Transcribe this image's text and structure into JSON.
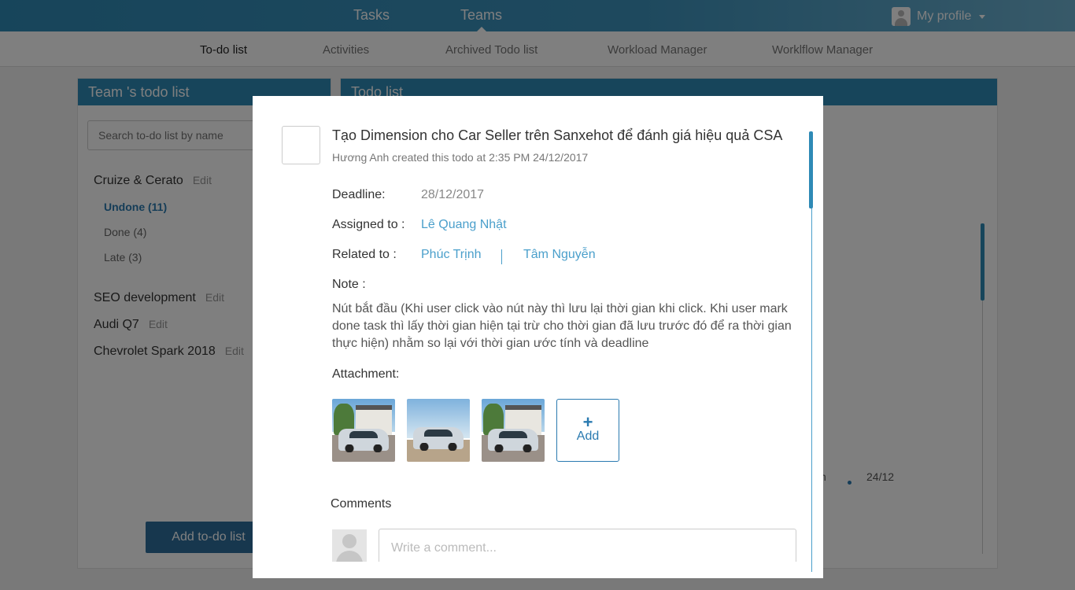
{
  "topbar": {
    "nav": [
      "Tasks",
      "Teams"
    ],
    "profile_label": "My profile"
  },
  "subnav": [
    "To-do list",
    "Activities",
    "Archived Todo list",
    "Workload Manager",
    "Worklflow Manager"
  ],
  "left_panel": {
    "title": "Team 's todo list",
    "search_placeholder": "Search to-do list by name",
    "edit_label": "Edit",
    "groups": [
      "Cruize & Cerato",
      "SEO development",
      "Audi Q7",
      "Chevrolet Spark 2018"
    ],
    "filters": [
      "Undone (11)",
      "Done (4)",
      "Late (3)"
    ],
    "add_button": "Add to-do list"
  },
  "right_panel": {
    "title": "Todo list",
    "row_fragment": "h",
    "row_date": "24/12"
  },
  "modal": {
    "title": "Tạo Dimension cho Car Seller trên Sanxehot để đánh giá hiệu quả CSA",
    "meta": "Hương Anh created this todo at 2:35 PM 24/12/2017",
    "deadline_label": "Deadline:",
    "deadline_value": "28/12/2017",
    "assigned_label": "Assigned to :",
    "assigned_value": "Lê Quang Nhật",
    "related_label": "Related to :",
    "related": [
      "Phúc Trịnh",
      "Tâm Nguyễn"
    ],
    "note_label": "Note :",
    "note_text": "Nút bắt đầu (Khi user click vào nút này thì lưu lại thời gian khi click. Khi user mark done task thì lấy thời gian hiện tại trừ cho thời gian đã lưu trước đó để ra thời gian thực hiện) nhằm so lại với thời gian ước tính và deadline",
    "attachment_label": "Attachment:",
    "add_attachment_plus": "+",
    "add_attachment_label": "Add",
    "comments_label": "Comments",
    "comment_placeholder": "Write a comment..."
  }
}
